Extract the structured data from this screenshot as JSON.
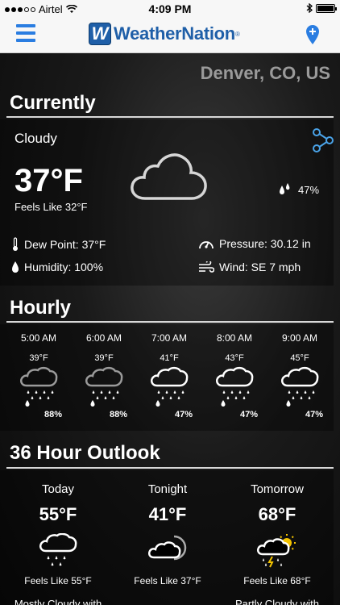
{
  "status_bar": {
    "carrier": "Airtel",
    "time": "4:09 PM",
    "bluetooth_icon": "bluetooth-icon",
    "wifi_icon": "wifi-icon"
  },
  "nav": {
    "logo_letter": "W",
    "logo_text": "WeatherNation",
    "logo_mark": "®"
  },
  "location": "Denver, CO, US",
  "currently": {
    "title": "Currently",
    "condition": "Cloudy",
    "temperature": "37°F",
    "feels_like": "Feels Like 32°F",
    "precip": "47%",
    "dew_point": "Dew Point: 37°F",
    "humidity": "Humidity: 100%",
    "pressure": "Pressure: 30.12 in",
    "wind": "Wind: SE 7 mph"
  },
  "hourly": {
    "title": "Hourly",
    "items": [
      {
        "time": "5:00 AM",
        "temp": "39°F",
        "precip": "88%",
        "icon": "rain-cloud-icon"
      },
      {
        "time": "6:00 AM",
        "temp": "39°F",
        "precip": "88%",
        "icon": "rain-cloud-icon"
      },
      {
        "time": "7:00 AM",
        "temp": "41°F",
        "precip": "47%",
        "icon": "rain-cloud-icon"
      },
      {
        "time": "8:00 AM",
        "temp": "43°F",
        "precip": "47%",
        "icon": "rain-cloud-icon"
      },
      {
        "time": "9:00 AM",
        "temp": "45°F",
        "precip": "47%",
        "icon": "rain-cloud-icon"
      }
    ]
  },
  "outlook": {
    "title": "36 Hour Outlook",
    "items": [
      {
        "label": "Today",
        "temp": "55°F",
        "feels": "Feels Like 55°F",
        "desc": "Mostly Cloudy with",
        "icon": "rain-cloud-icon"
      },
      {
        "label": "Tonight",
        "temp": "41°F",
        "feels": "Feels Like 37°F",
        "desc": "",
        "icon": "cloudy-moon-icon"
      },
      {
        "label": "Tomorrow",
        "temp": "68°F",
        "feels": "Feels Like 68°F",
        "desc": "Partly Cloudy with",
        "icon": "sun-thunder-rain-icon"
      }
    ]
  },
  "colors": {
    "brand_blue": "#1f5fa8",
    "accent_blue": "#2a7de1",
    "city_gray": "#9a9a9a",
    "sun_yellow": "#f2c200"
  }
}
